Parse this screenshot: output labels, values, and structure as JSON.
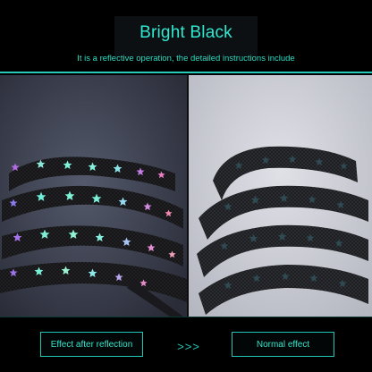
{
  "header": {
    "title": "Bright Black",
    "subtitle": "It is a reflective operation, the detailed instructions include"
  },
  "footer": {
    "left_button": "Effect after reflection",
    "arrows": ">>>",
    "right_button": "Normal effect"
  },
  "colors": {
    "accent": "#31e8d0",
    "background": "#000000",
    "left_photo_bg": "#3a3d4c",
    "right_photo_bg": "#c9cbd3"
  },
  "photos": [
    {
      "name": "reflective-laces-photo",
      "subject": "black star-print shoelaces glowing rainbow under flash"
    },
    {
      "name": "normal-laces-photo",
      "subject": "black star-print shoelaces under normal light"
    }
  ]
}
